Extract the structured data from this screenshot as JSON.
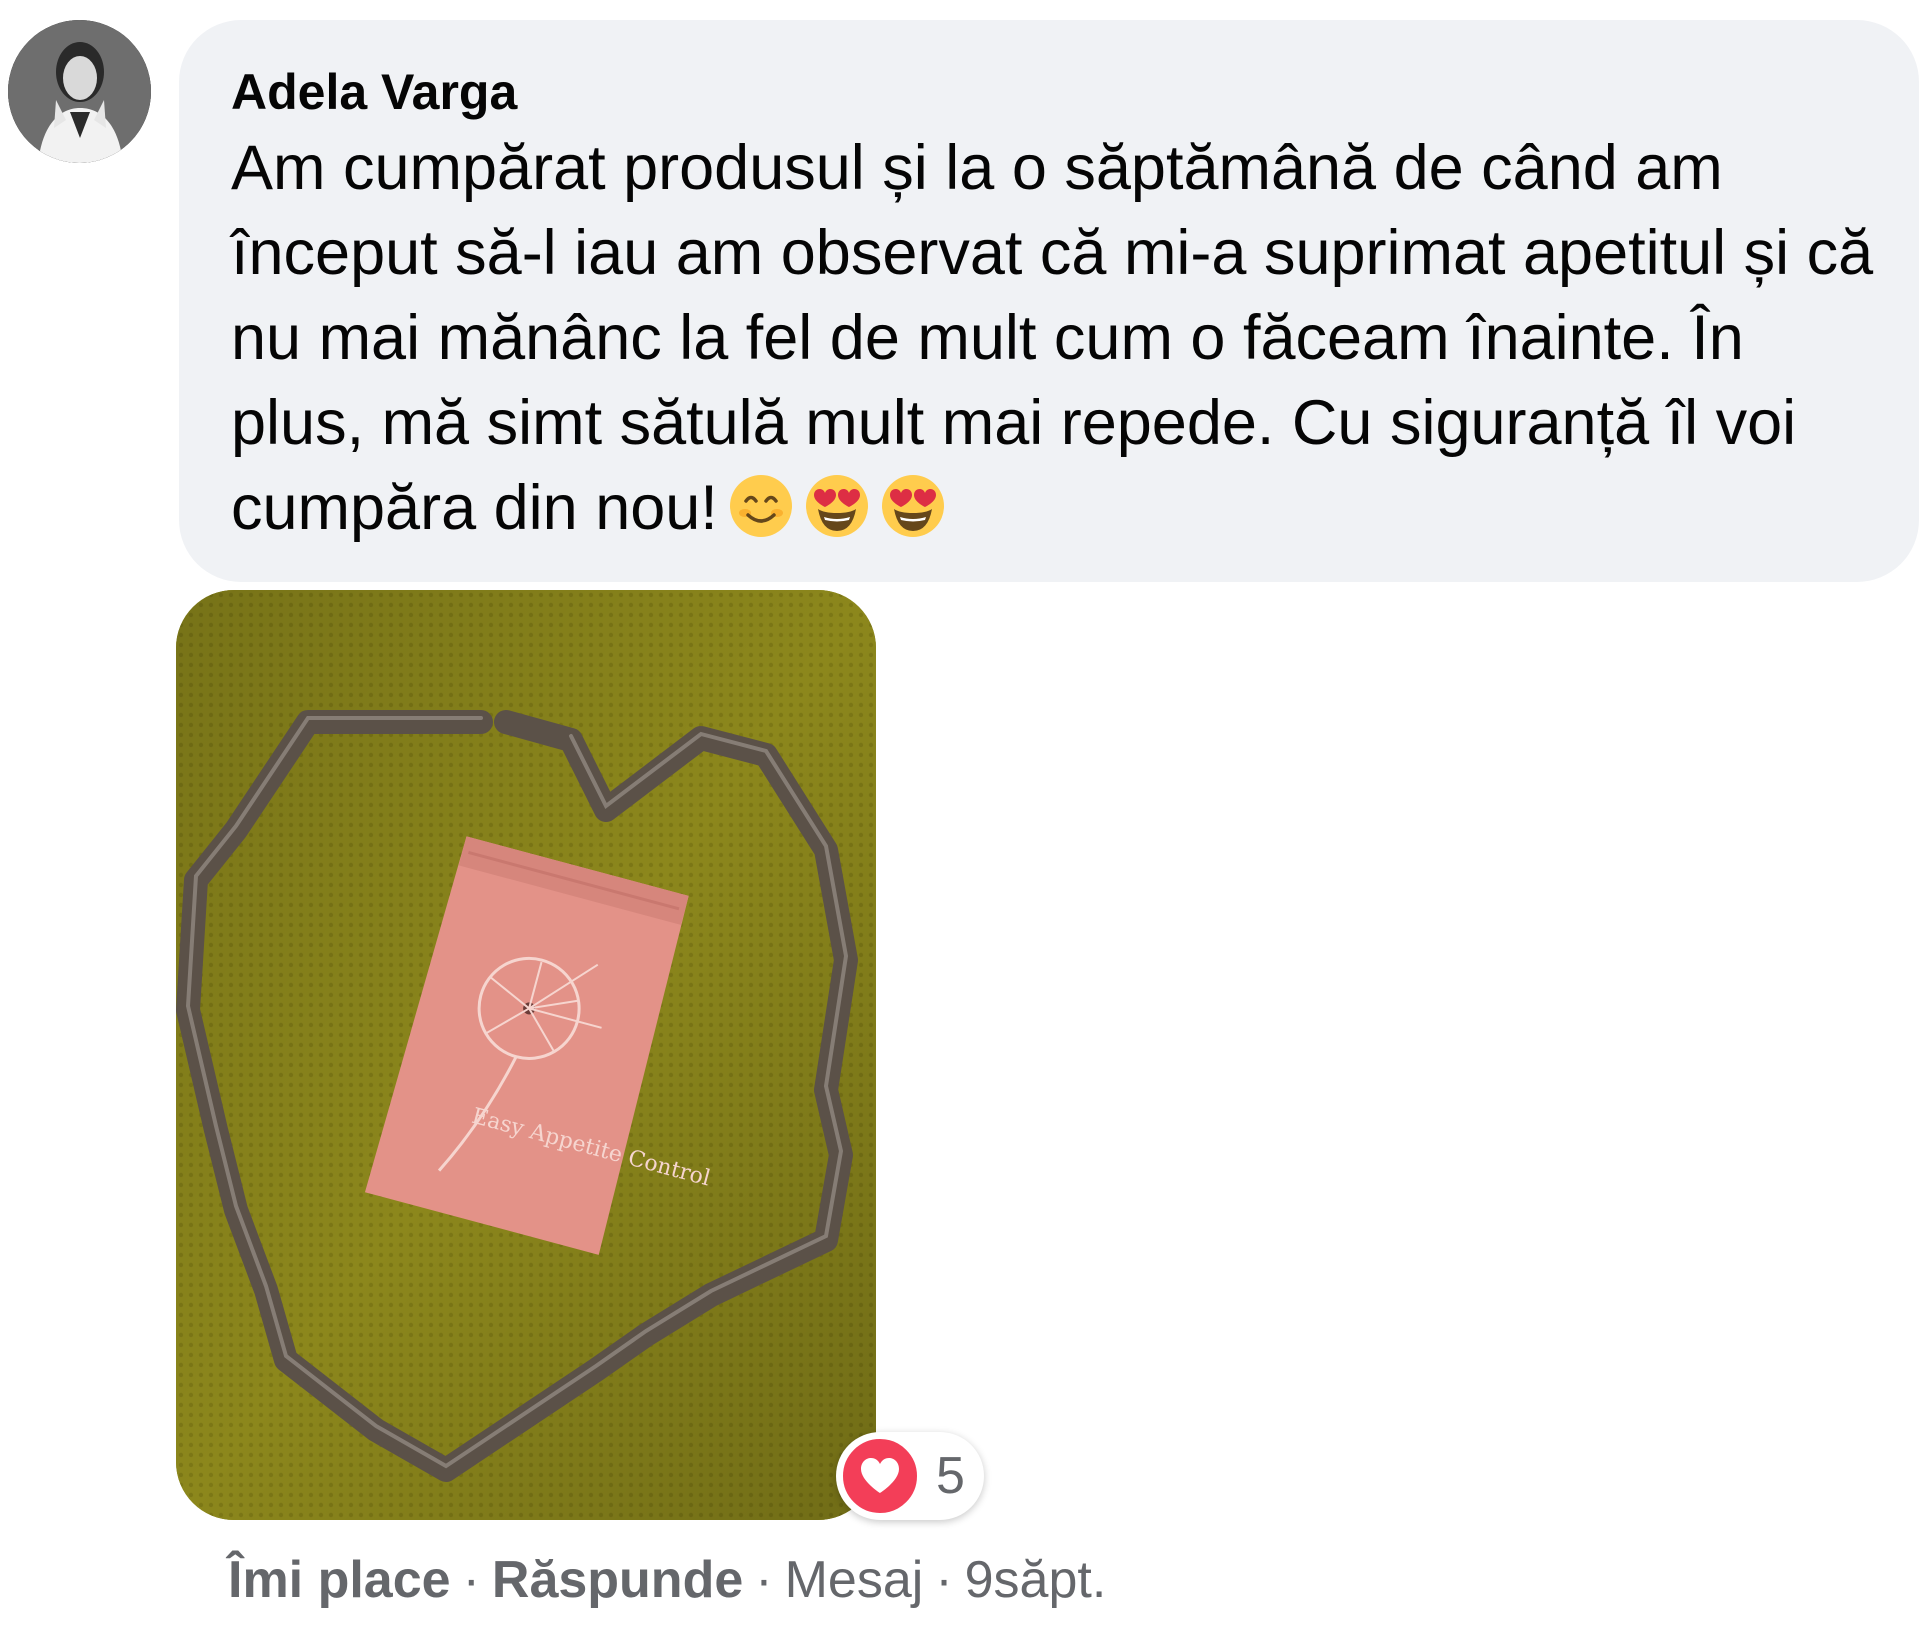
{
  "comment": {
    "author": "Adela Varga",
    "text": "Am cumpărat produsul și la o săptămână de când am început să-l iau am observat că mi-a suprimat apetitul și că nu mai mănânc la fel de mult cum o făceam înainte. În plus, mă simt sătulă mult mai repede. Cu siguranță îl voi cumpăra din nou!",
    "emojis": [
      "smiling-face-icon",
      "heart-eyes-icon",
      "heart-eyes-icon"
    ]
  },
  "photo": {
    "package_text": "Easy Appetite Control"
  },
  "reactions": {
    "type": "heart-icon",
    "count": "5",
    "color": "#f33e58"
  },
  "actions": {
    "like": "Îmi place",
    "reply": "Răspunde",
    "message": "Mesaj",
    "time": "9săpt.",
    "separator": "·"
  },
  "colors": {
    "bubble": "#f0f2f5",
    "meta": "#65676b",
    "text": "#050505"
  }
}
